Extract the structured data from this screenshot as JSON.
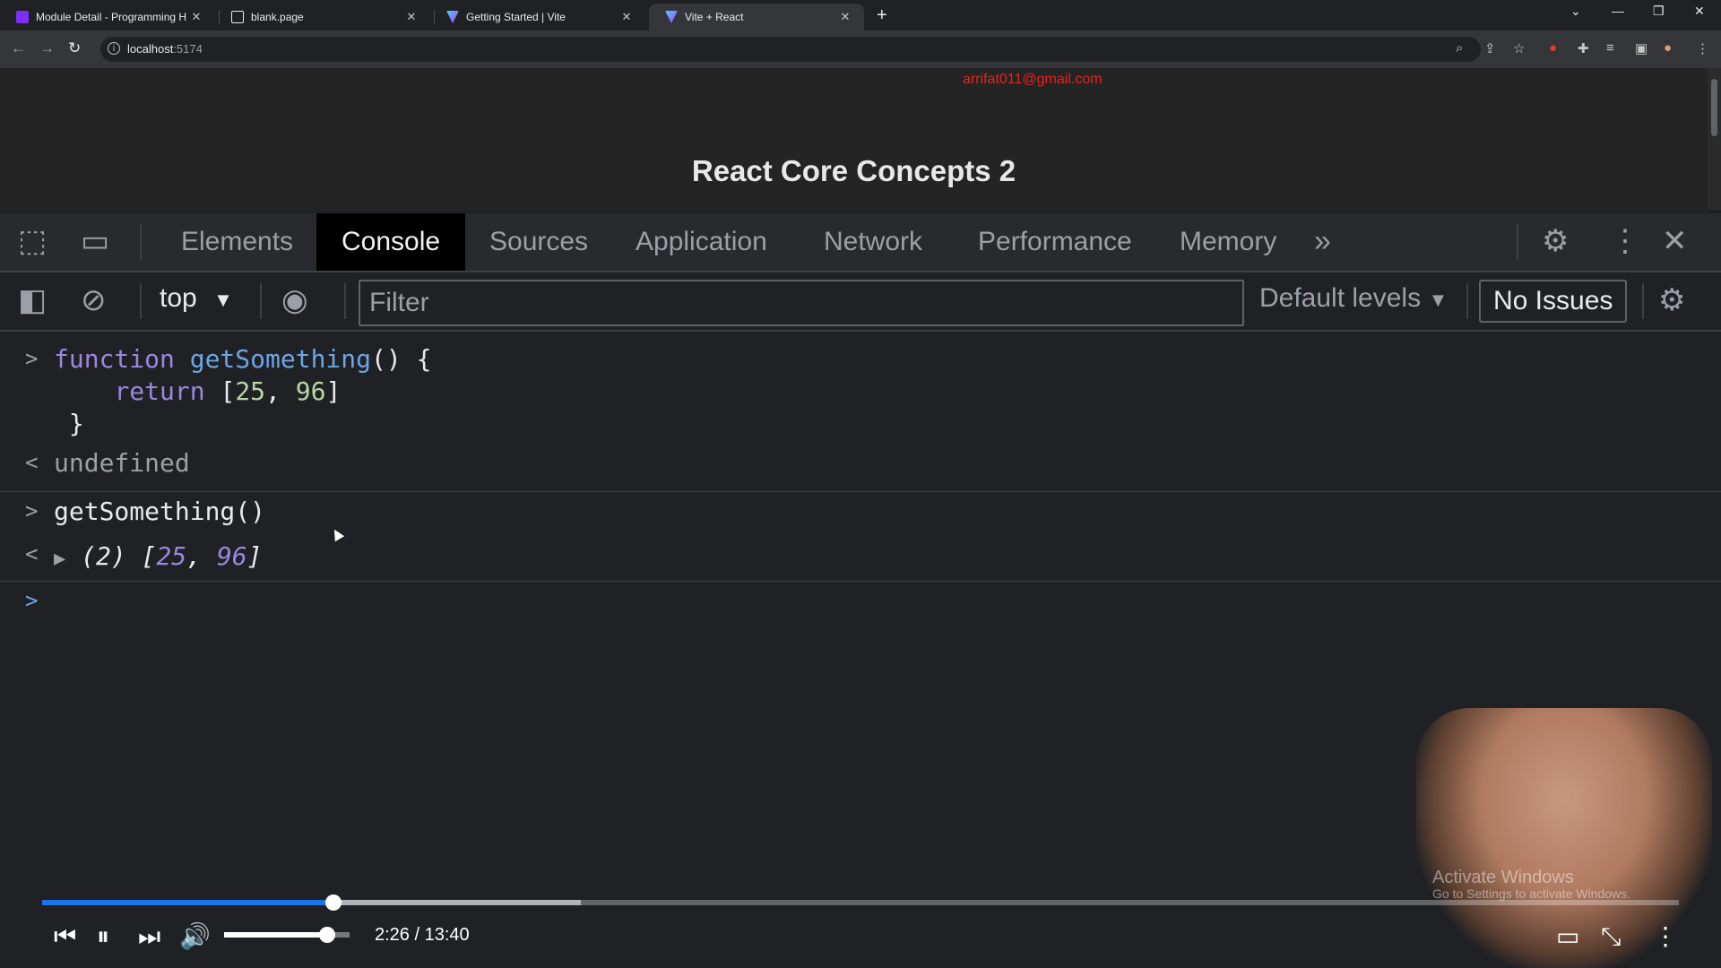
{
  "browser": {
    "tabs": [
      {
        "title": "Module Detail - Programming H",
        "favicon_color": "#7b2ff7",
        "active": false
      },
      {
        "title": "blank.page",
        "favicon_color": "#e8eaed",
        "active": false
      },
      {
        "title": "Getting Started | Vite",
        "favicon_color": "#bd34fe",
        "active": false
      },
      {
        "title": "Vite + React",
        "favicon_color": "#bd34fe",
        "active": true
      }
    ],
    "url_host": "localhost",
    "url_port": ":5174"
  },
  "page": {
    "email": "arrifat011@gmail.com",
    "title": "React Core Concepts 2"
  },
  "devtools": {
    "tabs": [
      "Elements",
      "Console",
      "Sources",
      "Application",
      "Network",
      "Performance",
      "Memory"
    ],
    "active_tab": "Console",
    "context": "top",
    "filter_placeholder": "Filter",
    "levels": "Default levels",
    "issues": "No Issues"
  },
  "console": {
    "input1": {
      "line1_kw": "function",
      "line1_fn": "getSomething",
      "line1_rest": "() {",
      "line2_kw": "return",
      "line2_open": "[",
      "line2_a": "25",
      "line2_sep": ", ",
      "line2_b": "96",
      "line2_close": "]",
      "line3": "}"
    },
    "output1": "undefined",
    "input2": "getSomething()",
    "output2_count": "(2)",
    "output2_open": "[",
    "output2_a": "25",
    "output2_sep": ", ",
    "output2_b": "96",
    "output2_close": "]"
  },
  "watermark": {
    "line1": "Activate Windows",
    "line2": "Go to Settings to activate Windows."
  },
  "player": {
    "time": "2:26 / 13:40",
    "progress_fraction": 0.178,
    "buffered_fraction": 0.329,
    "volume_fraction": 0.82
  }
}
